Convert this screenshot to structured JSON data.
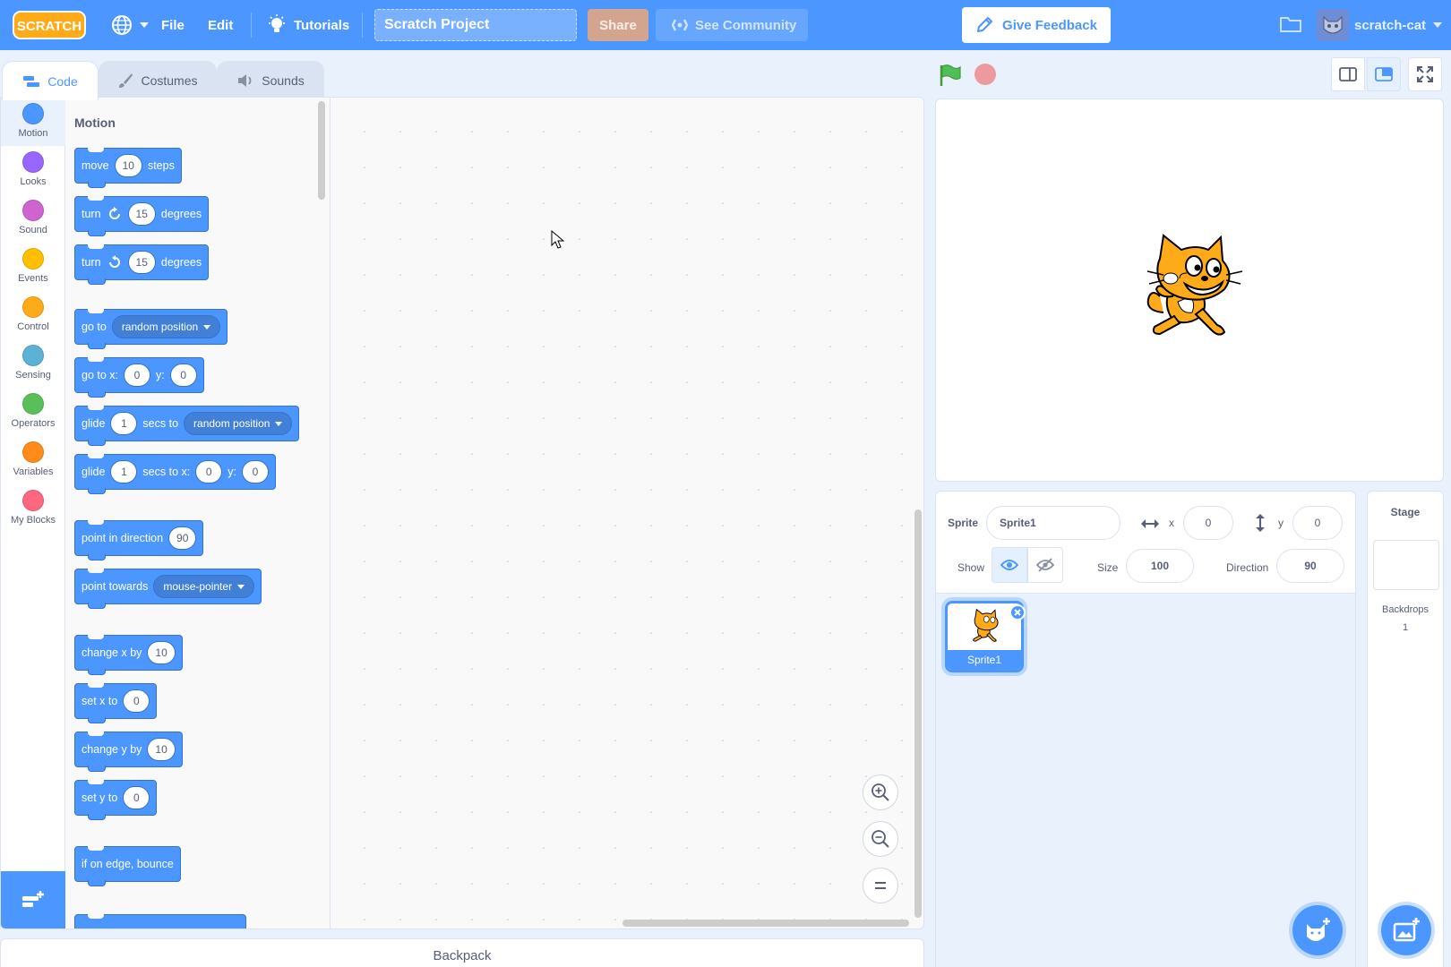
{
  "menubar": {
    "logo_text": "SCRATCH",
    "file": "File",
    "edit": "Edit",
    "tutorials": "Tutorials",
    "project_title": "Scratch Project",
    "share": "Share",
    "see_community": "See Community",
    "give_feedback": "Give Feedback",
    "username": "scratch-cat"
  },
  "tabs": {
    "code": "Code",
    "costumes": "Costumes",
    "sounds": "Sounds"
  },
  "categories": [
    {
      "label": "Motion",
      "color": "#4c97ff"
    },
    {
      "label": "Looks",
      "color": "#9966ff"
    },
    {
      "label": "Sound",
      "color": "#cf63cf"
    },
    {
      "label": "Events",
      "color": "#ffbf00"
    },
    {
      "label": "Control",
      "color": "#ffab19"
    },
    {
      "label": "Sensing",
      "color": "#5cb1d6"
    },
    {
      "label": "Operators",
      "color": "#59c059"
    },
    {
      "label": "Variables",
      "color": "#ff8c1a"
    },
    {
      "label": "My Blocks",
      "color": "#ff6680"
    }
  ],
  "flyout": {
    "title": "Motion",
    "move": {
      "t1": "move",
      "v": "10",
      "t2": "steps"
    },
    "turn_right": {
      "t1": "turn",
      "v": "15",
      "t2": "degrees"
    },
    "turn_left": {
      "t1": "turn",
      "v": "15",
      "t2": "degrees"
    },
    "goto": {
      "t1": "go to",
      "dd": "random position"
    },
    "goto_xy": {
      "t1": "go to x:",
      "x": "0",
      "t2": "y:",
      "y": "0"
    },
    "glide_to": {
      "t1": "glide",
      "v": "1",
      "t2": "secs to",
      "dd": "random position"
    },
    "glide_xy": {
      "t1": "glide",
      "v": "1",
      "t2": "secs to x:",
      "x": "0",
      "t3": "y:",
      "y": "0"
    },
    "point_dir": {
      "t1": "point in direction",
      "v": "90"
    },
    "point_towards": {
      "t1": "point towards",
      "dd": "mouse-pointer"
    },
    "change_x": {
      "t1": "change x by",
      "v": "10"
    },
    "set_x": {
      "t1": "set x to",
      "v": "0"
    },
    "change_y": {
      "t1": "change y by",
      "v": "10"
    },
    "set_y": {
      "t1": "set y to",
      "v": "0"
    },
    "bounce": {
      "t1": "if on edge, bounce"
    }
  },
  "backpack": "Backpack",
  "sprite_info": {
    "sprite_label": "Sprite",
    "sprite_name": "Sprite1",
    "x_label": "x",
    "x_value": "0",
    "y_label": "y",
    "y_value": "0",
    "show_label": "Show",
    "size_label": "Size",
    "size_value": "100",
    "direction_label": "Direction",
    "direction_value": "90"
  },
  "sprites": [
    {
      "name": "Sprite1",
      "selected": true
    }
  ],
  "stage_pane": {
    "title": "Stage",
    "backdrops_label": "Backdrops",
    "backdrops_count": "1"
  },
  "colors": {
    "primary": "#4c97ff",
    "menubar": "#4c97ff",
    "motion_block": "#4c97ff",
    "stop": "#ec9a9f",
    "flag": "#4cbf56",
    "cat_orange": "#ffab19"
  }
}
